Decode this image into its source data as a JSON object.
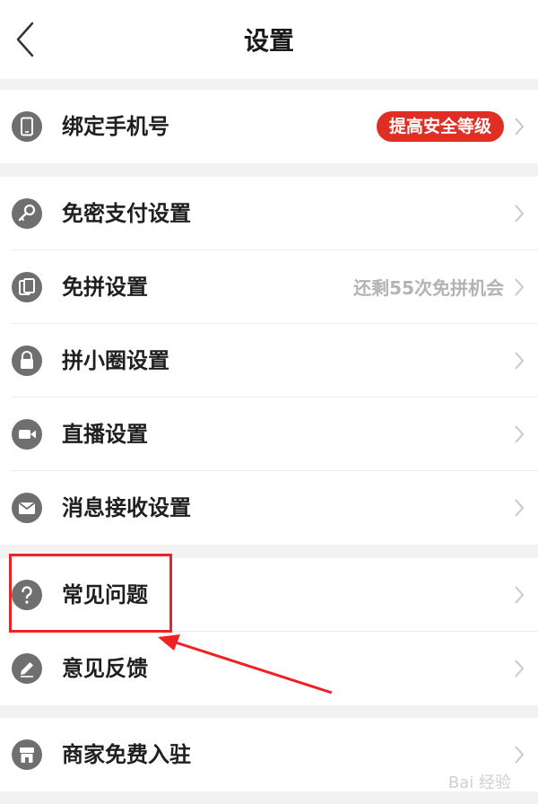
{
  "header": {
    "title": "设置",
    "back_icon": "chevron-left-icon"
  },
  "accent_color": "#e02e24",
  "rows": [
    {
      "label": "绑定手机号",
      "icon": "phone-icon",
      "badge": "提高安全等级"
    },
    {
      "label": "免密支付设置",
      "icon": "key-icon"
    },
    {
      "label": "免拼设置",
      "icon": "cards-icon",
      "value": "还剩55次免拼机会"
    },
    {
      "label": "拼小圈设置",
      "icon": "lock-icon"
    },
    {
      "label": "直播设置",
      "icon": "video-camera-icon"
    },
    {
      "label": "消息接收设置",
      "icon": "envelope-icon"
    },
    {
      "label": "常见问题",
      "icon": "question-icon"
    },
    {
      "label": "意见反馈",
      "icon": "pencil-icon"
    },
    {
      "label": "商家免费入驻",
      "icon": "store-icon"
    }
  ],
  "watermark": "Bai 经验"
}
